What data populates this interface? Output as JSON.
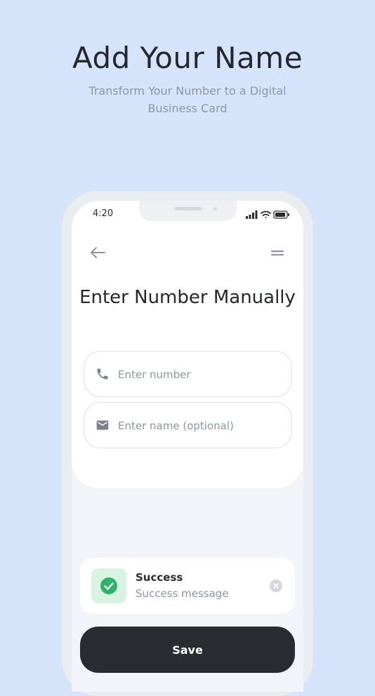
{
  "promo": {
    "title": "Add Your Name",
    "subtitle": "Transform Your Number to a Digital Business Card"
  },
  "status_bar": {
    "time": "4:20"
  },
  "header": {
    "back_icon": "arrow-left-icon",
    "menu_icon": "menu-icon"
  },
  "screen": {
    "title": "Enter Number Manually"
  },
  "form": {
    "number_placeholder": "Enter number",
    "number_value": "",
    "number_icon": "phone-icon",
    "name_placeholder": "Enter name (optional)",
    "name_value": "",
    "name_icon": "envelope-icon"
  },
  "toast": {
    "title": "Success",
    "message": "Success message",
    "icon": "check-circle-icon",
    "close_icon": "close-circle-icon"
  },
  "actions": {
    "save_label": "Save"
  },
  "colors": {
    "background": "#d6e4fb",
    "dark": "#2a2c31",
    "muted": "#8e96a3",
    "success": "#2fb36b",
    "success_bg": "#d8f3e1"
  }
}
